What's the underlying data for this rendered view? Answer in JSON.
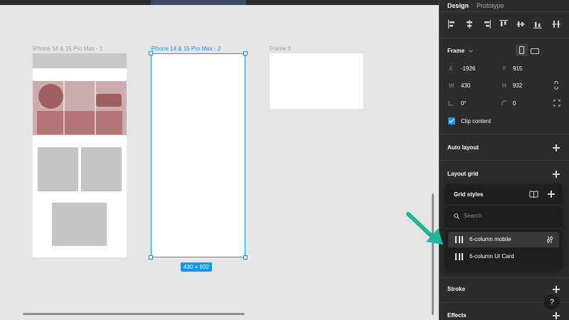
{
  "canvas": {
    "frames": [
      {
        "label": "iPhone 14 & 15 Pro Max - 1"
      },
      {
        "label": "iPhone 14 & 15 Pro Max - 2"
      },
      {
        "label": "Frame 3"
      }
    ],
    "selection_size": "430 × 932"
  },
  "panel": {
    "tabs": {
      "design": "Design",
      "prototype": "Prototype"
    },
    "frame": {
      "title": "Frame",
      "x_label": "X",
      "x_value": "-1926",
      "y_label": "Y",
      "y_value": "915",
      "w_label": "W",
      "w_value": "430",
      "h_label": "H",
      "h_value": "932",
      "rotation_value": "0°",
      "radius_value": "0",
      "clip_content_label": "Clip content",
      "clip_content_checked": true
    },
    "sections": {
      "auto_layout": "Auto layout",
      "layout_grid": "Layout grid",
      "stroke": "Stroke",
      "effects": "Effects"
    }
  },
  "grid_styles_popup": {
    "title": "Grid styles",
    "search_placeholder": "Search",
    "items": [
      {
        "name": "6-column mobile",
        "hovered": true
      },
      {
        "name": "6-column UI Card",
        "hovered": false
      }
    ]
  },
  "help": {
    "label": "?"
  },
  "colors": {
    "accent": "#0d99ff",
    "panel_bg": "#2c2c2c",
    "canvas_bg": "#e5e5e5",
    "arrow": "#1fb89a"
  },
  "icons": [
    "align-left-icon",
    "align-center-h-icon",
    "align-right-icon",
    "align-top-icon",
    "align-middle-v-icon",
    "align-bottom-icon",
    "distribute-icon",
    "chevron-down-icon",
    "portrait-icon",
    "landscape-icon",
    "constrain-proportions-icon",
    "corner-radius-icon",
    "independent-corners-icon",
    "book-icon",
    "plus-icon",
    "search-icon",
    "grid-icon",
    "adjust-icon",
    "arrow-icon"
  ]
}
